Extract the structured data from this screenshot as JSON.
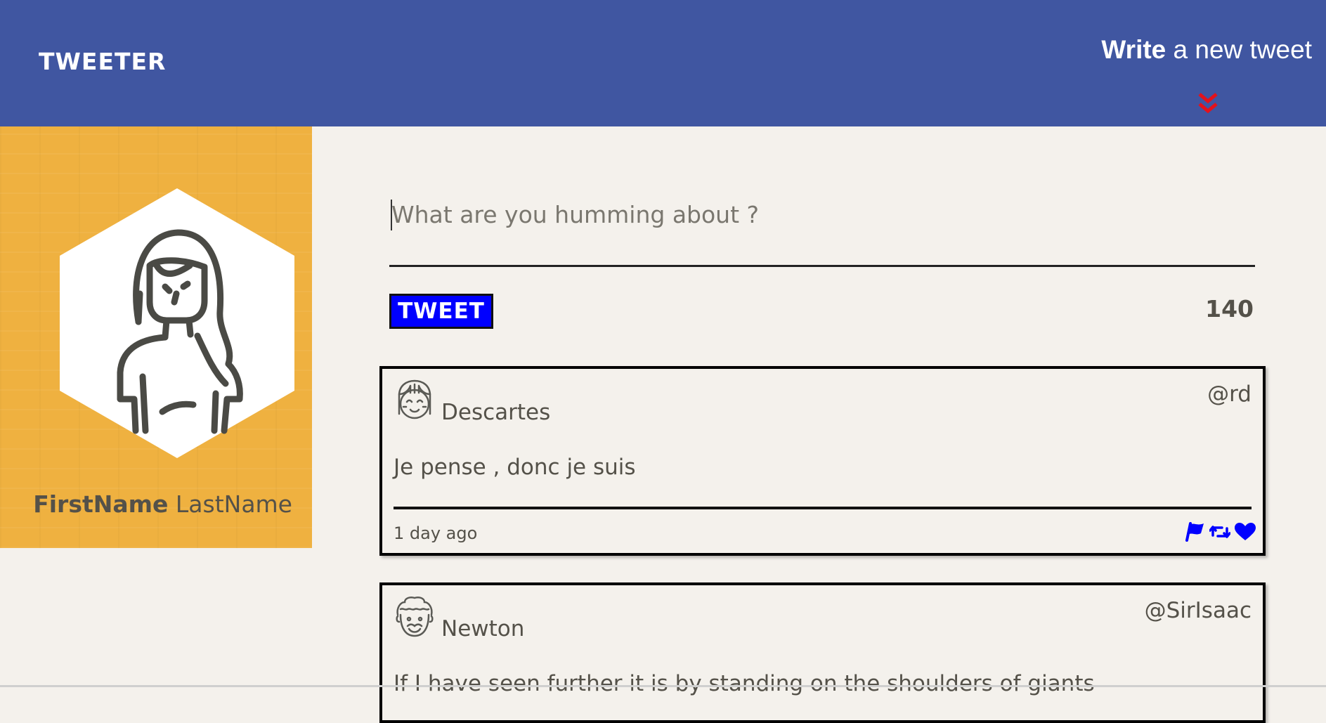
{
  "header": {
    "brand": "TWEETER",
    "write_bold": "Write",
    "write_rest": " a new tweet",
    "toggle_icon": "double-chevron-down-icon",
    "bg_color": "#4056a1",
    "chevron_color": "#e3121b"
  },
  "profile": {
    "first_name": "FirstName",
    "last_name": "LastName",
    "avatar_icon": "girl-avatar-icon",
    "bg_color": "#efb140"
  },
  "composer": {
    "placeholder": "What are you humming about ?",
    "value": "",
    "button_label": "TWEET",
    "counter": "140",
    "button_color": "#0000ff"
  },
  "tweets": [
    {
      "author": "Descartes",
      "handle": "@rd",
      "avatar_icon": "smiling-face-icon",
      "text": "Je pense , donc je suis",
      "age": "1 day ago",
      "actions": [
        "flag-icon",
        "retweet-icon",
        "heart-icon"
      ]
    },
    {
      "author": "Newton",
      "handle": "@SirIsaac",
      "avatar_icon": "curly-hair-face-icon",
      "text": "If I have seen further it is by standing on the shoulders of giants"
    }
  ],
  "action_color": "#0000ff"
}
